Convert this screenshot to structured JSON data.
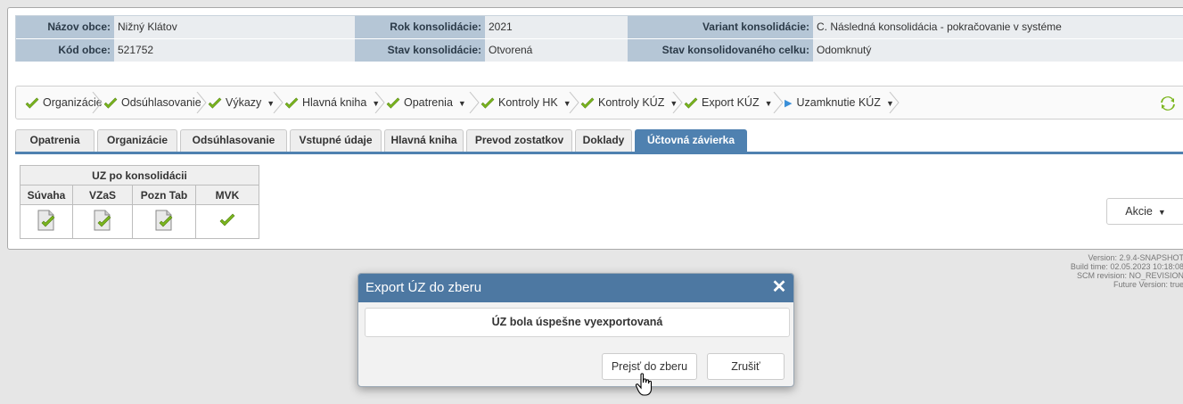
{
  "header": {
    "nazov_obce_label": "Názov obce:",
    "nazov_obce_value": "Nižný Klátov",
    "kod_obce_label": "Kód obce:",
    "kod_obce_value": "521752",
    "rok_label": "Rok konsolidácie:",
    "rok_value": "2021",
    "stav_label": "Stav konsolidácie:",
    "stav_value": "Otvorená",
    "variant_label": "Variant konsolidácie:",
    "variant_value": "C. Následná konsolidácia - pokračovanie v systéme",
    "stav_celku_label": "Stav konsolidovaného celku:",
    "stav_celku_value": "Odomknutý"
  },
  "workflow": [
    {
      "label": "Organizácie",
      "dropdown": false
    },
    {
      "label": "Odsúhlasovanie",
      "dropdown": false
    },
    {
      "label": "Výkazy",
      "dropdown": true
    },
    {
      "label": "Hlavná kniha",
      "dropdown": true
    },
    {
      "label": "Opatrenia",
      "dropdown": true
    },
    {
      "label": "Kontroly HK",
      "dropdown": true
    },
    {
      "label": "Kontroly KÚZ",
      "dropdown": true
    },
    {
      "label": "Export KÚZ",
      "dropdown": true
    },
    {
      "label": "Uzamknutie KÚZ",
      "dropdown": true
    }
  ],
  "tabs": [
    "Opatrenia",
    "Organizácie",
    "Odsúhlasovanie",
    "Vstupné údaje",
    "Hlavná kniha",
    "Prevod zostatkov",
    "Doklady",
    "Účtovná závierka"
  ],
  "active_tab": "Účtovná závierka",
  "uz_table": {
    "group_header": "UZ po konsolidácii",
    "columns": [
      "Súvaha",
      "VZaS",
      "Pozn Tab",
      "MVK"
    ]
  },
  "akcie_label": "Akcie",
  "version": {
    "line1": "Version: 2.9.4-SNAPSHOT",
    "line2": "Build time: 02.05.2023 10:18:08",
    "line3": "SCM revision: NO_REVISION",
    "line4": "Future Version: true"
  },
  "modal": {
    "title": "Export ÚZ do zberu",
    "message": "ÚZ bola úspešne vyexportovaná",
    "primary_button": "Prejsť do zberu",
    "cancel_button": "Zrušiť"
  },
  "colors": {
    "accent": "#4f81b0",
    "check": "#7ab51d",
    "label_bg": "#b5c6d6"
  }
}
